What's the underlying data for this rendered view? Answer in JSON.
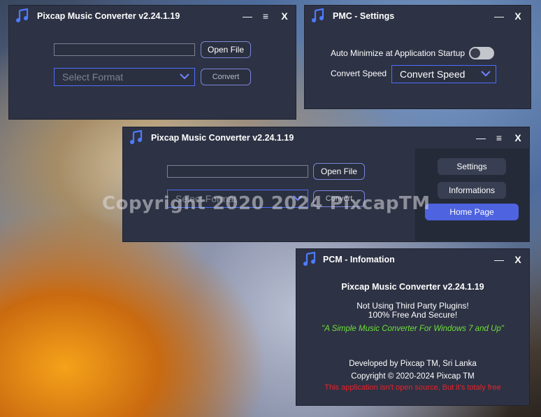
{
  "main_window": {
    "title": "Pixcap Music Converter v2.24.1.19",
    "minimize": "—",
    "menu": "≡",
    "close": "X",
    "file_path": "",
    "open_file": "Open File",
    "format_placeholder": "Select Format",
    "convert": "Convert"
  },
  "settings_window": {
    "title": "PMC - Settings",
    "minimize": "—",
    "close": "X",
    "auto_minimize_label": "Auto Minimize at Application Startup",
    "auto_minimize_on": false,
    "convert_speed_label": "Convert Speed",
    "convert_speed_value": "Convert Speed"
  },
  "second_window": {
    "title": "Pixcap Music Converter v2.24.1.19",
    "minimize": "—",
    "menu": "≡",
    "close": "X",
    "open_file": "Open File",
    "format_placeholder": "Select Format",
    "convert": "Convert",
    "side_menu": [
      "Settings",
      "Informations",
      "Home Page"
    ],
    "active_item": "Home Page",
    "watermark": "Copyright 2020  2024 PixcapTM"
  },
  "info_window": {
    "title": "PCM - Infomation",
    "minimize": "—",
    "close": "X",
    "app_name": "Pixcap Music Converter v2.24.1.19",
    "line1": "Not Using Third Party Plugins!",
    "line2": "100% Free And Secure!",
    "tagline": "\"A Simple Music Converter For Windows 7 and Up\"",
    "developer": "Developed by Pixcap TM, Sri Lanka",
    "copyright": "Copyright © 2020-2024 Pixcap TM",
    "disclaimer": "This application isn't open source, But it's totaly free",
    "tagline_color": "#6ee03a",
    "disclaimer_color": "#e8222a"
  },
  "colors": {
    "accent": "#4d63e0",
    "window_bg": "#2d3244",
    "select_border": "#4f6fff"
  }
}
